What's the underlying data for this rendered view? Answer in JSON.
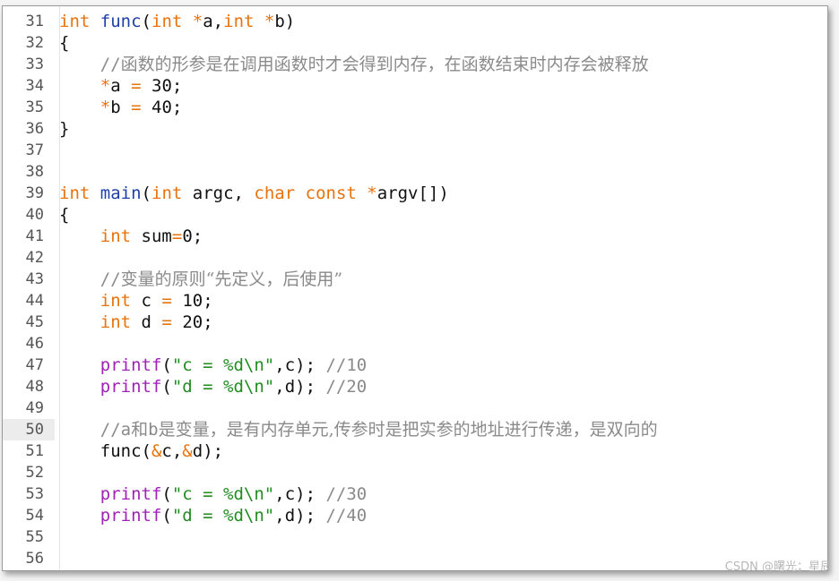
{
  "editor": {
    "active_line": "50",
    "lines": [
      {
        "n": "31",
        "tokens": [
          [
            "kw",
            "int"
          ],
          [
            "plain",
            " "
          ],
          [
            "fn",
            "func"
          ],
          [
            "plain",
            "("
          ],
          [
            "kw",
            "int"
          ],
          [
            "plain",
            " "
          ],
          [
            "op",
            "*"
          ],
          [
            "plain",
            "a,"
          ],
          [
            "kw",
            "int"
          ],
          [
            "plain",
            " "
          ],
          [
            "op",
            "*"
          ],
          [
            "plain",
            "b)"
          ]
        ]
      },
      {
        "n": "32",
        "tokens": [
          [
            "plain",
            "{"
          ]
        ]
      },
      {
        "n": "33",
        "tokens": [
          [
            "plain",
            "    "
          ],
          [
            "cmt",
            "//"
          ],
          [
            "cmtcn",
            "函数的形参是在调用函数时才会得到内存，在函数结束时内存会被释放"
          ]
        ]
      },
      {
        "n": "34",
        "tokens": [
          [
            "plain",
            "    "
          ],
          [
            "op",
            "*"
          ],
          [
            "plain",
            "a "
          ],
          [
            "op",
            "="
          ],
          [
            "plain",
            " 30;"
          ]
        ]
      },
      {
        "n": "35",
        "tokens": [
          [
            "plain",
            "    "
          ],
          [
            "op",
            "*"
          ],
          [
            "plain",
            "b "
          ],
          [
            "op",
            "="
          ],
          [
            "plain",
            " 40;"
          ]
        ]
      },
      {
        "n": "36",
        "tokens": [
          [
            "plain",
            "}"
          ]
        ]
      },
      {
        "n": "37",
        "tokens": []
      },
      {
        "n": "38",
        "tokens": []
      },
      {
        "n": "39",
        "tokens": [
          [
            "kw",
            "int"
          ],
          [
            "plain",
            " "
          ],
          [
            "fn",
            "main"
          ],
          [
            "plain",
            "("
          ],
          [
            "kw",
            "int"
          ],
          [
            "plain",
            " argc, "
          ],
          [
            "kw",
            "char"
          ],
          [
            "plain",
            " "
          ],
          [
            "kw",
            "const"
          ],
          [
            "plain",
            " "
          ],
          [
            "op",
            "*"
          ],
          [
            "plain",
            "argv[])"
          ]
        ]
      },
      {
        "n": "40",
        "tokens": [
          [
            "plain",
            "{"
          ]
        ]
      },
      {
        "n": "41",
        "tokens": [
          [
            "plain",
            "    "
          ],
          [
            "kw",
            "int"
          ],
          [
            "plain",
            " sum"
          ],
          [
            "op",
            "="
          ],
          [
            "plain",
            "0;"
          ]
        ]
      },
      {
        "n": "42",
        "tokens": []
      },
      {
        "n": "43",
        "tokens": [
          [
            "plain",
            "    "
          ],
          [
            "cmt",
            "//"
          ],
          [
            "cmtcn",
            "变量的原则“先定义，后使用”"
          ]
        ]
      },
      {
        "n": "44",
        "tokens": [
          [
            "plain",
            "    "
          ],
          [
            "kw",
            "int"
          ],
          [
            "plain",
            " c "
          ],
          [
            "op",
            "="
          ],
          [
            "plain",
            " 10;"
          ]
        ]
      },
      {
        "n": "45",
        "tokens": [
          [
            "plain",
            "    "
          ],
          [
            "kw",
            "int"
          ],
          [
            "plain",
            " d "
          ],
          [
            "op",
            "="
          ],
          [
            "plain",
            " 20;"
          ]
        ]
      },
      {
        "n": "46",
        "tokens": []
      },
      {
        "n": "47",
        "tokens": [
          [
            "plain",
            "    "
          ],
          [
            "pf",
            "printf"
          ],
          [
            "plain",
            "("
          ],
          [
            "str",
            "\"c = %d\\n\""
          ],
          [
            "plain",
            ",c); "
          ],
          [
            "cmt",
            "//10"
          ]
        ]
      },
      {
        "n": "48",
        "tokens": [
          [
            "plain",
            "    "
          ],
          [
            "pf",
            "printf"
          ],
          [
            "plain",
            "("
          ],
          [
            "str",
            "\"d = %d\\n\""
          ],
          [
            "plain",
            ",d); "
          ],
          [
            "cmt",
            "//20"
          ]
        ]
      },
      {
        "n": "49",
        "tokens": []
      },
      {
        "n": "50",
        "tokens": [
          [
            "plain",
            "    "
          ],
          [
            "cmt",
            "//a"
          ],
          [
            "cmtcn",
            "和"
          ],
          [
            "cmt",
            "b"
          ],
          [
            "cmtcn",
            "是变量，是有内存单元,传参时是把实参的地址进行传递，是双向的"
          ]
        ]
      },
      {
        "n": "51",
        "tokens": [
          [
            "plain",
            "    func("
          ],
          [
            "op",
            "&"
          ],
          [
            "plain",
            "c,"
          ],
          [
            "op",
            "&"
          ],
          [
            "plain",
            "d);"
          ]
        ]
      },
      {
        "n": "52",
        "tokens": []
      },
      {
        "n": "53",
        "tokens": [
          [
            "plain",
            "    "
          ],
          [
            "pf",
            "printf"
          ],
          [
            "plain",
            "("
          ],
          [
            "str",
            "\"c = %d\\n\""
          ],
          [
            "plain",
            ",c); "
          ],
          [
            "cmt",
            "//30"
          ]
        ]
      },
      {
        "n": "54",
        "tokens": [
          [
            "plain",
            "    "
          ],
          [
            "pf",
            "printf"
          ],
          [
            "plain",
            "("
          ],
          [
            "str",
            "\"d = %d\\n\""
          ],
          [
            "plain",
            ",d); "
          ],
          [
            "cmt",
            "//40"
          ]
        ]
      },
      {
        "n": "55",
        "tokens": []
      },
      {
        "n": "56",
        "tokens": []
      }
    ]
  },
  "watermark": "CSDN @曙光；星辰",
  "colors": {
    "keyword": "#e8720c",
    "function": "#1f3fa8",
    "printf": "#a021b8",
    "string": "#228b22",
    "comment": "#8a8a8a"
  }
}
